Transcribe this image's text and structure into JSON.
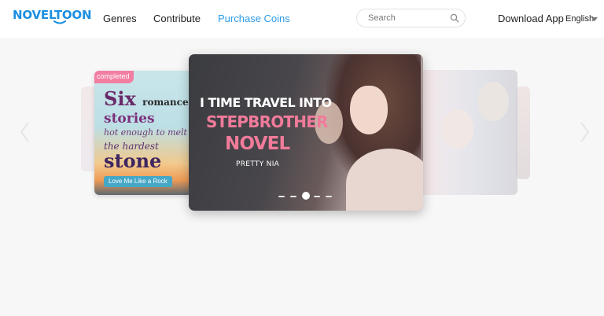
{
  "header": {
    "logo": "NOVELTOON",
    "nav": [
      "Genres",
      "Contribute",
      "Purchase Coins"
    ],
    "search": {
      "placeholder": "Search",
      "value": ""
    },
    "download_label": "Download App",
    "language": "English"
  },
  "carousel": {
    "active_index": 2,
    "dot_count": 5,
    "left_card": {
      "badge": "completed",
      "title_big": "Six",
      "title_small": "romance",
      "title_line2": "stories",
      "title_line3": "hot enough to melt",
      "title_line4": "the hardest",
      "title_line5": "stone",
      "subtitle": "Love Me Like a Rock"
    },
    "main_card": {
      "title_line1": "I TIME TRAVEL INTO",
      "title_line2": "STEPBROTHER",
      "title_line3": "NOVEL",
      "author": "PRETTY NIA"
    },
    "right_card": {}
  },
  "colors": {
    "brand": "#1c8fe0",
    "nav_active": "#2c9bea",
    "title_pink": "#f07b9a",
    "badge_pink": "#f27ea1"
  }
}
